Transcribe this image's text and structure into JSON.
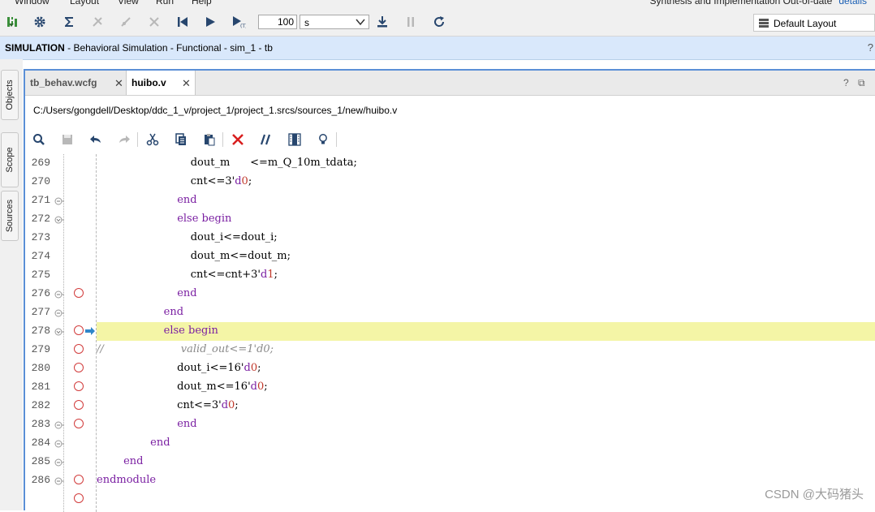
{
  "menubar": {
    "items": [
      "Window",
      "Layout",
      "View",
      "Run",
      "Help"
    ],
    "status_text": "Synthesis and Implementation Out-of-date",
    "details_link": "details"
  },
  "toolbar": {
    "run_time_value": "100",
    "run_time_unit": "s",
    "layout_label": "Default Layout"
  },
  "banner": {
    "mode": "SIMULATION",
    "description": " - Behavioral Simulation - Functional - sim_1 - tb",
    "help": "?"
  },
  "left_tabs": [
    "Objects",
    "Scope",
    "Sources"
  ],
  "editor": {
    "tabs": [
      {
        "label": "tb_behav.wcfg",
        "active": false
      },
      {
        "label": "huibo.v",
        "active": true
      }
    ],
    "file_path": "C:/Users/gongdell/Desktop/ddc_1_v/project_1/project_1.srcs/sources_1/new/huibo.v",
    "help": "?",
    "restore": "⧉"
  },
  "code_lines": [
    {
      "n": "269",
      "fold": "",
      "bp": false,
      "arrow": false,
      "hl": false,
      "segs": [
        [
          "t",
          "                            dout_m      <=m_Q_10m_tdata;"
        ]
      ]
    },
    {
      "n": "270",
      "fold": "",
      "bp": false,
      "arrow": false,
      "hl": false,
      "segs": [
        [
          "t",
          "                            cnt<=3'"
        ],
        [
          "k",
          "d"
        ],
        [
          "n",
          "0"
        ],
        [
          "t",
          ";"
        ]
      ]
    },
    {
      "n": "271",
      "fold": "end",
      "bp": false,
      "arrow": false,
      "hl": false,
      "segs": [
        [
          "t",
          "                        "
        ],
        [
          "k",
          "end"
        ]
      ]
    },
    {
      "n": "272",
      "fold": "begin",
      "bp": false,
      "arrow": false,
      "hl": false,
      "segs": [
        [
          "t",
          "                        "
        ],
        [
          "k",
          "else begin"
        ]
      ]
    },
    {
      "n": "273",
      "fold": "",
      "bp": false,
      "arrow": false,
      "hl": false,
      "segs": [
        [
          "t",
          "                            dout_i<=dout_i;"
        ]
      ]
    },
    {
      "n": "274",
      "fold": "",
      "bp": false,
      "arrow": false,
      "hl": false,
      "segs": [
        [
          "t",
          "                            dout_m<=dout_m;"
        ]
      ]
    },
    {
      "n": "275",
      "fold": "",
      "bp": false,
      "arrow": false,
      "hl": false,
      "segs": [
        [
          "t",
          "                            cnt<=cnt+3'"
        ],
        [
          "k",
          "d"
        ],
        [
          "n",
          "1"
        ],
        [
          "t",
          ";"
        ]
      ]
    },
    {
      "n": "276",
      "fold": "end",
      "bp": true,
      "arrow": false,
      "hl": false,
      "segs": [
        [
          "t",
          "                        "
        ],
        [
          "k",
          "end"
        ]
      ]
    },
    {
      "n": "277",
      "fold": "end",
      "bp": false,
      "arrow": false,
      "hl": false,
      "segs": [
        [
          "t",
          "                    "
        ],
        [
          "k",
          "end"
        ]
      ]
    },
    {
      "n": "278",
      "fold": "begin",
      "bp": true,
      "arrow": true,
      "hl": true,
      "segs": [
        [
          "t",
          "                    "
        ],
        [
          "k",
          "else begin"
        ]
      ]
    },
    {
      "n": "279",
      "fold": "",
      "bp": true,
      "arrow": false,
      "hl": false,
      "segs": [
        [
          "c",
          "//                       valid_out<=1'd0;"
        ]
      ]
    },
    {
      "n": "280",
      "fold": "",
      "bp": true,
      "arrow": false,
      "hl": false,
      "segs": [
        [
          "t",
          "                        dout_i<=16'"
        ],
        [
          "k",
          "d"
        ],
        [
          "n",
          "0"
        ],
        [
          "t",
          ";"
        ]
      ]
    },
    {
      "n": "281",
      "fold": "",
      "bp": true,
      "arrow": false,
      "hl": false,
      "segs": [
        [
          "t",
          "                        dout_m<=16'"
        ],
        [
          "k",
          "d"
        ],
        [
          "n",
          "0"
        ],
        [
          "t",
          ";"
        ]
      ]
    },
    {
      "n": "282",
      "fold": "",
      "bp": true,
      "arrow": false,
      "hl": false,
      "segs": [
        [
          "t",
          "                        cnt<=3'"
        ],
        [
          "k",
          "d"
        ],
        [
          "n",
          "0"
        ],
        [
          "t",
          ";"
        ]
      ]
    },
    {
      "n": "283",
      "fold": "end",
      "bp": true,
      "arrow": false,
      "hl": false,
      "segs": [
        [
          "t",
          "                        "
        ],
        [
          "k",
          "end"
        ]
      ]
    },
    {
      "n": "284",
      "fold": "end",
      "bp": false,
      "arrow": false,
      "hl": false,
      "segs": [
        [
          "t",
          "                "
        ],
        [
          "k",
          "end"
        ]
      ]
    },
    {
      "n": "285",
      "fold": "end",
      "bp": false,
      "arrow": false,
      "hl": false,
      "segs": [
        [
          "t",
          "        "
        ],
        [
          "k",
          "end"
        ]
      ]
    },
    {
      "n": "286",
      "fold": "end",
      "bp": true,
      "arrow": false,
      "hl": false,
      "segs": [
        [
          "k",
          "endmodule"
        ]
      ]
    },
    {
      "n": "",
      "fold": "",
      "bp": true,
      "arrow": false,
      "hl": false,
      "segs": []
    }
  ],
  "watermark": "CSDN @大码猪头"
}
